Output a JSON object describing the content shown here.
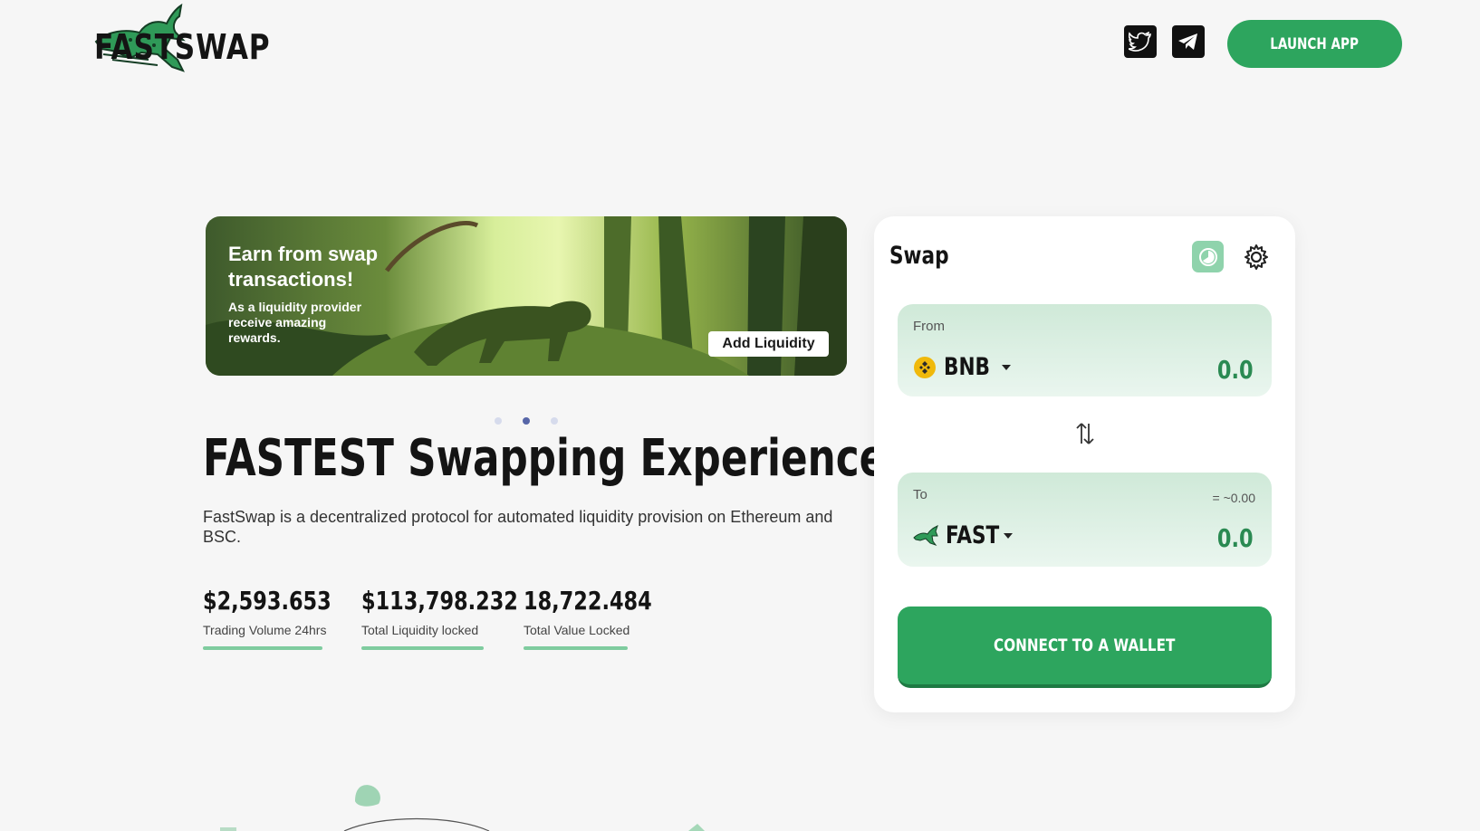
{
  "header": {
    "brand": "FASTSWAP",
    "launch_label": "LAUNCH APP",
    "social": [
      {
        "name": "twitter",
        "icon": "twitter-icon"
      },
      {
        "name": "telegram",
        "icon": "telegram-icon"
      }
    ]
  },
  "banner": {
    "title": "Earn from swap transactions!",
    "subtitle": "As a liquidity provider receive amazing rewards.",
    "button_label": "Add Liquidity",
    "dots_count": 3,
    "active_dot": 1
  },
  "hero": {
    "title": "FASTEST Swapping Experience",
    "description": "FastSwap is a decentralized protocol for automated liquidity provision on Ethereum and BSC."
  },
  "stats": [
    {
      "value": "$2,593.653",
      "label": "Trading Volume 24hrs"
    },
    {
      "value": "$113,798.232",
      "label": "Total Liquidity locked"
    },
    {
      "value": "18,722.484",
      "label": "Total Value Locked"
    }
  ],
  "swap": {
    "title": "Swap",
    "from": {
      "label": "From",
      "token": "BNB",
      "amount": "0.0",
      "icon": "bnb-icon"
    },
    "to": {
      "label": "To",
      "token": "FAST",
      "amount": "0.0",
      "estimate": "= ~0.00",
      "icon": "fast-token-icon"
    },
    "connect_label": "CONNECT TO A WALLET"
  },
  "colors": {
    "accent": "#2da55e",
    "amount": "#2a8a52",
    "background": "#f6f6f6"
  }
}
